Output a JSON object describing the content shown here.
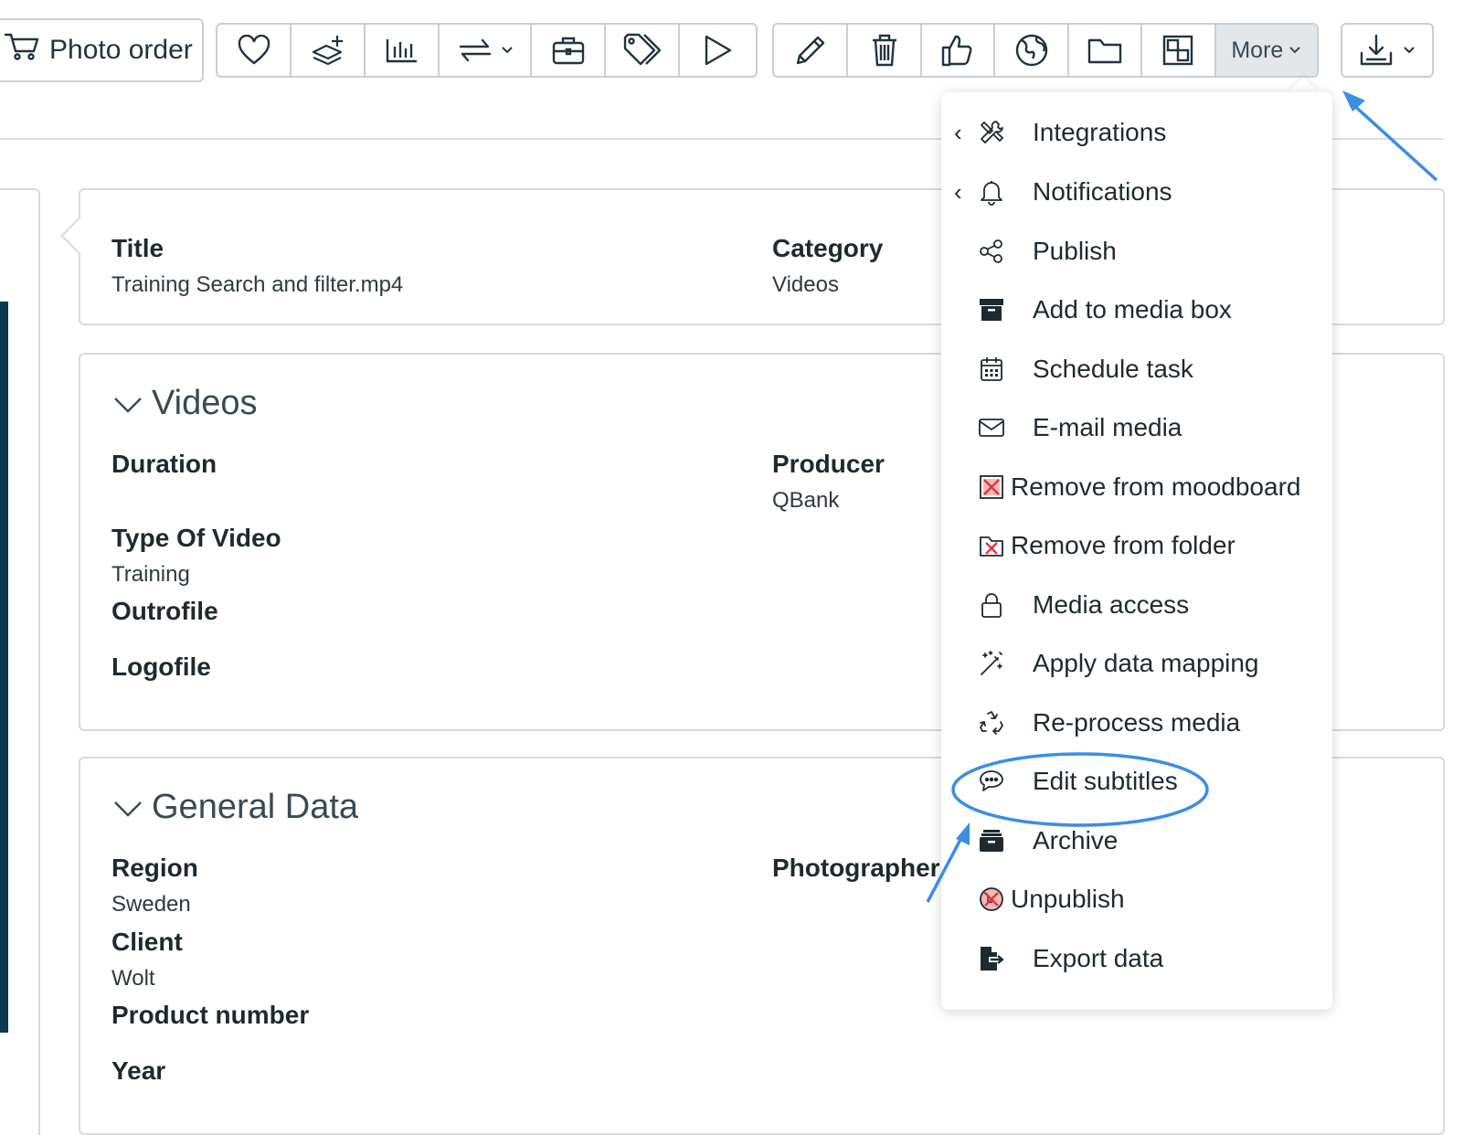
{
  "toolbar": {
    "photo_order_label": "Photo order",
    "more_label": "More",
    "icons": [
      "heart-icon",
      "add-to-moodboard-icon",
      "statistics-icon",
      "transfer-icon",
      "briefcase-icon",
      "tag-icon",
      "play-icon",
      "pencil-icon",
      "trash-icon",
      "thumbs-up-icon",
      "globe-icon",
      "folder-icon",
      "layout-icon",
      "download-icon"
    ]
  },
  "title_card": {
    "title_label": "Title",
    "title_value": "Training Search and filter.mp4",
    "category_label": "Category",
    "category_value": "Videos"
  },
  "videos_section": {
    "heading": "Videos",
    "duration_label": "Duration",
    "producer_label": "Producer",
    "producer_value": "QBank",
    "type_label": "Type Of Video",
    "type_value": "Training",
    "outrofile_label": "Outrofile",
    "logofile_label": "Logofile"
  },
  "general_section": {
    "heading": "General Data",
    "region_label": "Region",
    "region_value": "Sweden",
    "photographer_label": "Photographer",
    "client_label": "Client",
    "client_value": "Wolt",
    "product_label": "Product number",
    "year_label": "Year"
  },
  "more_menu": {
    "items": [
      {
        "label": "Integrations",
        "icon": "tools-icon",
        "submenu": true
      },
      {
        "label": "Notifications",
        "icon": "bell-icon",
        "submenu": true
      },
      {
        "label": "Publish",
        "icon": "share-icon"
      },
      {
        "label": "Add to media box",
        "icon": "archive-box-icon"
      },
      {
        "label": "Schedule task",
        "icon": "calendar-icon"
      },
      {
        "label": "E-mail media",
        "icon": "envelope-icon"
      },
      {
        "label": "Remove from moodboard",
        "icon": "remove-moodboard-icon"
      },
      {
        "label": "Remove from folder",
        "icon": "remove-folder-icon"
      },
      {
        "label": "Media access",
        "icon": "lock-icon"
      },
      {
        "label": "Apply data mapping",
        "icon": "magic-wand-icon"
      },
      {
        "label": "Re-process media",
        "icon": "recycle-icon"
      },
      {
        "label": "Edit subtitles",
        "icon": "speech-bubble-icon"
      },
      {
        "label": "Archive",
        "icon": "archive-icon"
      },
      {
        "label": "Unpublish",
        "icon": "unpublish-icon"
      },
      {
        "label": "Export data",
        "icon": "export-file-icon"
      }
    ]
  },
  "colors": {
    "annotation_blue": "#3a8ee6",
    "accent_red": "#e0353a",
    "sidebar_dark": "#0b3a4e"
  }
}
